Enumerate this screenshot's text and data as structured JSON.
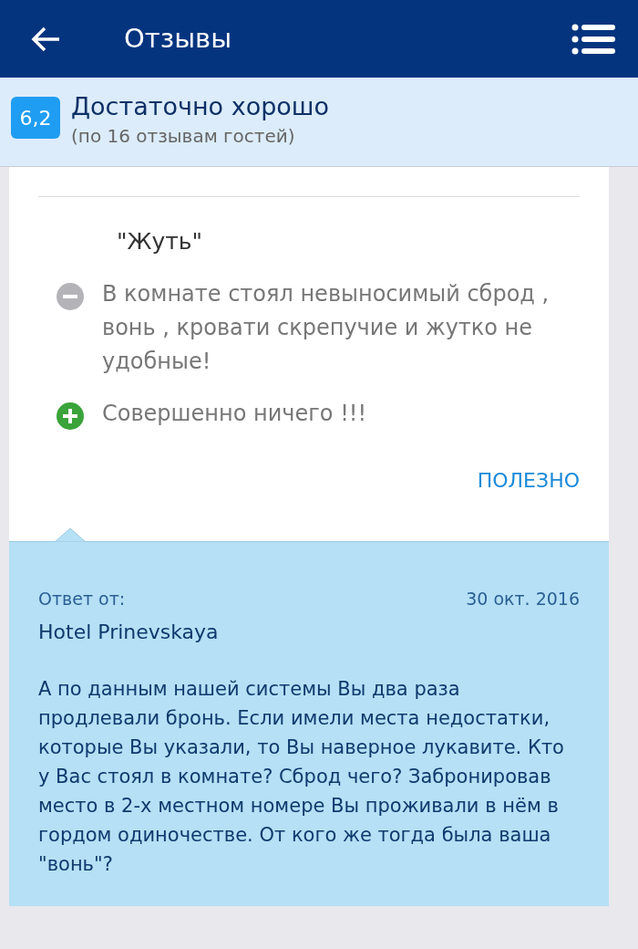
{
  "header": {
    "title": "Отзывы"
  },
  "summary": {
    "score": "6,2",
    "rating": "Достаточно хорошо",
    "count": "(по 16 отзывам гостей)"
  },
  "review": {
    "title": "\"Жуть\"",
    "points": [
      {
        "kind": "negative",
        "text": "В комнате стоял невыносимый сброд , вонь , кровати скрепучие и жутко не удобные!"
      },
      {
        "kind": "positive",
        "text": "Совершенно ничего !!!"
      }
    ],
    "helpful": "ПОЛЕЗНО"
  },
  "reply": {
    "label": "Ответ от:",
    "date": "30 окт. 2016",
    "author": "Hotel Prinevskaya",
    "text": "А по данным нашей системы Вы два раза продлевали бронь. Если имели места недостатки, которые Вы указали, то Вы наверное лукавите. Кто у Вас стоял в комнате? Сброд чего? Забронировав место в 2-х местном номере Вы проживали в нём в гордом одиночестве. От кого же тогда была ваша \"вонь\"?"
  }
}
